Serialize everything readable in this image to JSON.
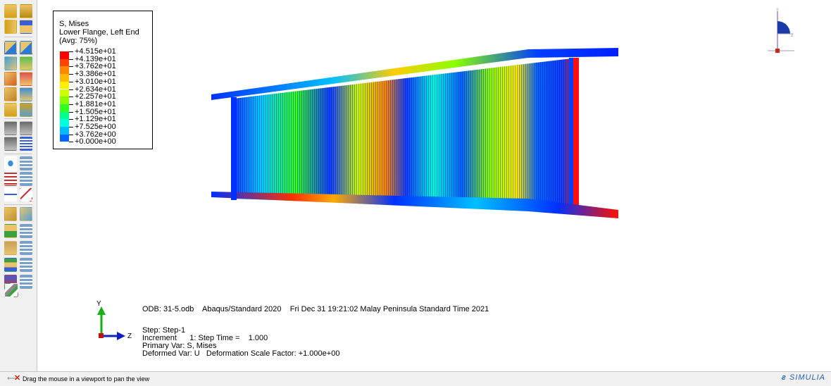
{
  "legend": {
    "title_lines": [
      "S, Mises",
      "Lower Flange, Left End",
      "(Avg: 75%)"
    ],
    "levels": [
      "+4.515e+01",
      "+4.139e+01",
      "+3.762e+01",
      "+3.386e+01",
      "+3.010e+01",
      "+2.634e+01",
      "+2.257e+01",
      "+1.881e+01",
      "+1.505e+01",
      "+1.129e+01",
      "+7.525e+00",
      "+3.762e+00",
      "+0.000e+00"
    ],
    "colors": [
      "#ff0000",
      "#ff4400",
      "#ff8800",
      "#ffbb00",
      "#ffee00",
      "#ccff00",
      "#88ff00",
      "#33ff22",
      "#00ff88",
      "#00ffdd",
      "#00bbff",
      "#0066ff",
      "#0000ff"
    ]
  },
  "triad": {
    "y_label": "Y",
    "z_label": "Z"
  },
  "info": {
    "line1": "ODB: 31-5.odb    Abaqus/Standard 2020    Fri Dec 31 19:21:02 Malay Peninsula Standard Time 2021",
    "line2": "Step: Step-1",
    "line3": "Increment      1: Step Time =    1.000",
    "line4": "Primary Var: S, Mises",
    "line5": "Deformed Var: U   Deformation Scale Factor: +1.000e+00"
  },
  "view_cube": {
    "y_label": "Y",
    "z_label": "Z",
    "x_label": "X"
  },
  "status": {
    "message": "Drag the mouse in a viewport to pan the view",
    "brand": "SIMULIA"
  },
  "icons": [
    "query-icon",
    "plot-contours-icon",
    "animate-icon",
    "xy-data-icon",
    "path-icon",
    "view-cut-icon",
    "pan-icon"
  ]
}
